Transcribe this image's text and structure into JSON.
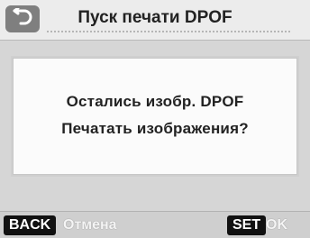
{
  "header": {
    "title": "Пуск печати DPOF"
  },
  "dialog": {
    "line1": "Остались изобр. DPOF",
    "line2": "Печатать изображения?"
  },
  "footer": {
    "back_key": "BACK",
    "back_action": "Отмена",
    "set_key": "SET",
    "set_action": "OK"
  },
  "icons": {
    "back": "return-arrow-icon"
  },
  "colors": {
    "accent": "#111111",
    "panel": "#d6d6d6"
  }
}
